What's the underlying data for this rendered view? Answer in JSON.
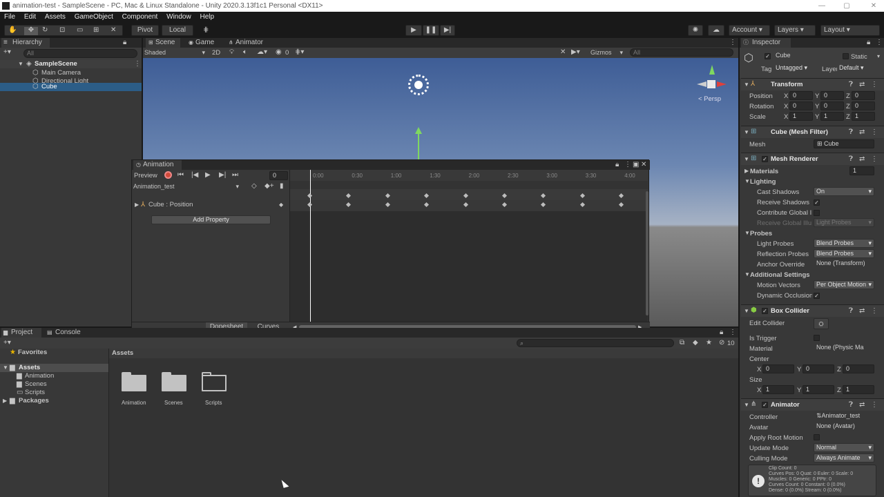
{
  "window": {
    "title": "animation-test - SampleScene - PC, Mac & Linux Standalone - Unity 2020.3.13f1c1 Personal <DX11>",
    "min": "—",
    "max": "▢",
    "close": "✕"
  },
  "menu": [
    "File",
    "Edit",
    "Assets",
    "GameObject",
    "Component",
    "Window",
    "Help"
  ],
  "toolbar": {
    "pivot": "Pivot",
    "local": "Local",
    "account": "Account",
    "layers": "Layers",
    "layout": "Layout"
  },
  "hierarchy": {
    "tab": "Hierarchy",
    "search": "All",
    "scene": "SampleScene",
    "items": [
      "Main Camera",
      "Directional Light",
      "Cube"
    ]
  },
  "scene": {
    "tabs": [
      "Scene",
      "Game",
      "Animator"
    ],
    "shading": "Shaded",
    "mode2d": "2D",
    "fx_count": "0",
    "gizmos": "Gizmos",
    "search": "All",
    "persp": "< Persp"
  },
  "animation": {
    "tab": "Animation",
    "preview": "Preview",
    "frame": "0",
    "clip": "Animation_test",
    "property": "Cube : Position",
    "add_property": "Add Property",
    "dopesheet": "Dopesheet",
    "curves": "Curves",
    "ruler": [
      "0:00",
      "0:30",
      "1:00",
      "1:30",
      "2:00",
      "2:30",
      "3:00",
      "3:30",
      "4:00"
    ]
  },
  "project": {
    "tabs": [
      "Project",
      "Console"
    ],
    "favorites": "Favorites",
    "assets": "Assets",
    "tree": [
      "Animation",
      "Scenes",
      "Scripts"
    ],
    "packages": "Packages",
    "breadcrumb": "Assets",
    "hidden_count": "10",
    "folders": [
      "Animation",
      "Scenes",
      "Scripts"
    ]
  },
  "inspector": {
    "tab": "Inspector",
    "object": "Cube",
    "static": "Static",
    "tag_label": "Tag",
    "tag": "Untagged",
    "layer_label": "Layer",
    "layer": "Default",
    "transform": {
      "title": "Transform",
      "position": "Position",
      "rotation": "Rotation",
      "scale": "Scale",
      "pos": [
        "0",
        "0",
        "0"
      ],
      "rot": [
        "0",
        "0",
        "0"
      ],
      "scl": [
        "1",
        "1",
        "1"
      ]
    },
    "meshfilter": {
      "title": "Cube (Mesh Filter)",
      "mesh_label": "Mesh",
      "mesh": "Cube"
    },
    "meshrenderer": {
      "title": "Mesh Renderer",
      "materials": "Materials",
      "materials_count": "1",
      "lighting": "Lighting",
      "cast_shadows": "Cast Shadows",
      "cast_shadows_val": "On",
      "receive_shadows": "Receive Shadows",
      "contribute_gi": "Contribute Global I",
      "receive_gi": "Receive Global Illu",
      "receive_gi_val": "Light Probes",
      "probes": "Probes",
      "light_probes": "Light Probes",
      "light_probes_val": "Blend Probes",
      "reflection_probes": "Reflection Probes",
      "reflection_probes_val": "Blend Probes",
      "anchor_override": "Anchor Override",
      "anchor_override_val": "None (Transform)",
      "additional": "Additional Settings",
      "motion_vectors": "Motion Vectors",
      "motion_vectors_val": "Per Object Motion",
      "dynamic_occlusion": "Dynamic Occlusion"
    },
    "boxcollider": {
      "title": "Box Collider",
      "edit_collider": "Edit Collider",
      "is_trigger": "Is Trigger",
      "material": "Material",
      "material_val": "None (Physic Ma",
      "center": "Center",
      "center_vals": [
        "0",
        "0",
        "0"
      ],
      "size": "Size",
      "size_vals": [
        "1",
        "1",
        "1"
      ]
    },
    "animator": {
      "title": "Animator",
      "controller": "Controller",
      "controller_val": "Animator_test",
      "avatar": "Avatar",
      "avatar_val": "None (Avatar)",
      "apply_root": "Apply Root Motion",
      "update_mode": "Update Mode",
      "update_mode_val": "Normal",
      "culling_mode": "Culling Mode",
      "culling_mode_val": "Always Animate",
      "info": [
        "Clip Count: 0",
        "Curves Pos: 0 Quat: 0 Euler: 0 Scale: 0",
        "Muscles: 0 Generic: 0 PPtr: 0",
        "Curves Count: 0 Constant: 0 (0.0%)",
        "Dense: 0 (0.0%) Stream: 0 (0.0%)"
      ]
    }
  }
}
